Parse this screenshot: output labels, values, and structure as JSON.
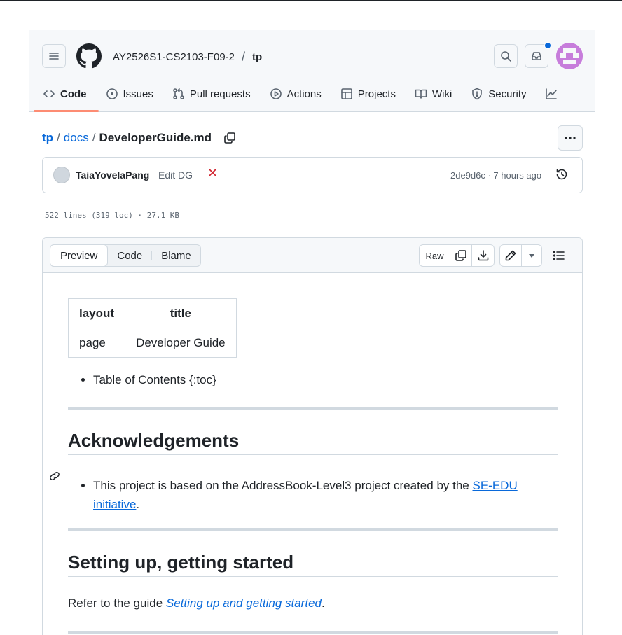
{
  "header": {
    "repo_owner": "AY2526S1-CS2103-F09-2",
    "repo_separator": "/",
    "repo_name": "tp"
  },
  "nav": {
    "tabs": [
      {
        "label": "Code",
        "icon": "code-icon",
        "selected": true
      },
      {
        "label": "Issues",
        "icon": "issue-opened-icon"
      },
      {
        "label": "Pull requests",
        "icon": "git-pull-request-icon"
      },
      {
        "label": "Actions",
        "icon": "play-icon"
      },
      {
        "label": "Projects",
        "icon": "table-icon"
      },
      {
        "label": "Wiki",
        "icon": "book-icon"
      },
      {
        "label": "Security",
        "icon": "shield-icon"
      }
    ]
  },
  "breadcrumb": {
    "repo": "tp",
    "sep1": "/",
    "folder": "docs",
    "sep2": "/",
    "file": "DeveloperGuide.md"
  },
  "commit": {
    "author": "TaiaYovelaPang",
    "message": "Edit DG",
    "status_glyph": "✕",
    "sha_time": "2de9d6c · 7 hours ago"
  },
  "file_meta": "522 lines (319 loc) · 27.1 KB",
  "toolbar": {
    "preview": "Preview",
    "code": "Code",
    "blame": "Blame",
    "raw": "Raw"
  },
  "content": {
    "table": {
      "headers": [
        "layout",
        "title"
      ],
      "rows": [
        [
          "page",
          "Developer Guide"
        ]
      ]
    },
    "toc_item": "Table of Contents {:toc}",
    "ack_heading": "Acknowledgements",
    "ack_text_before": "This project is based on the AddressBook-Level3 project created by the ",
    "ack_link": "SE-EDU initiative",
    "ack_text_after": ".",
    "setup_heading": "Setting up, getting started",
    "setup_text_before": "Refer to the guide ",
    "setup_link": "Setting up and getting started",
    "setup_text_after": "."
  },
  "colors": {
    "accent": "#0969da",
    "tab_underline": "#fd8c73",
    "status_fail": "#d1242f",
    "avatar": "#c77ddb"
  }
}
